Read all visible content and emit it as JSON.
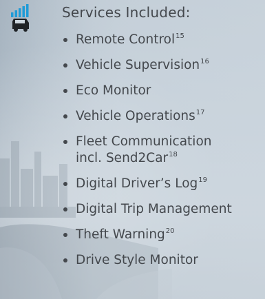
{
  "heading": "Services Included:",
  "icon": "connected-vehicle-signal-icon",
  "colors": {
    "text": "#44484d",
    "icon_bars": "#1e9bd7",
    "icon_car": "#1f2327"
  },
  "services": [
    {
      "label": "Remote Control",
      "note": "15"
    },
    {
      "label": "Vehicle Supervision",
      "note": "16"
    },
    {
      "label": "Eco Monitor",
      "note": ""
    },
    {
      "label": "Vehicle Operations",
      "note": "17"
    },
    {
      "label": "Fleet Communication",
      "label_line2": "incl. Send2Car",
      "note": "18"
    },
    {
      "label": "Digital Driver’s Log",
      "note": "19"
    },
    {
      "label": "Digital Trip Management",
      "note": ""
    },
    {
      "label": "Theft Warning",
      "note": "20"
    },
    {
      "label": "Drive Style Monitor",
      "note": ""
    }
  ]
}
